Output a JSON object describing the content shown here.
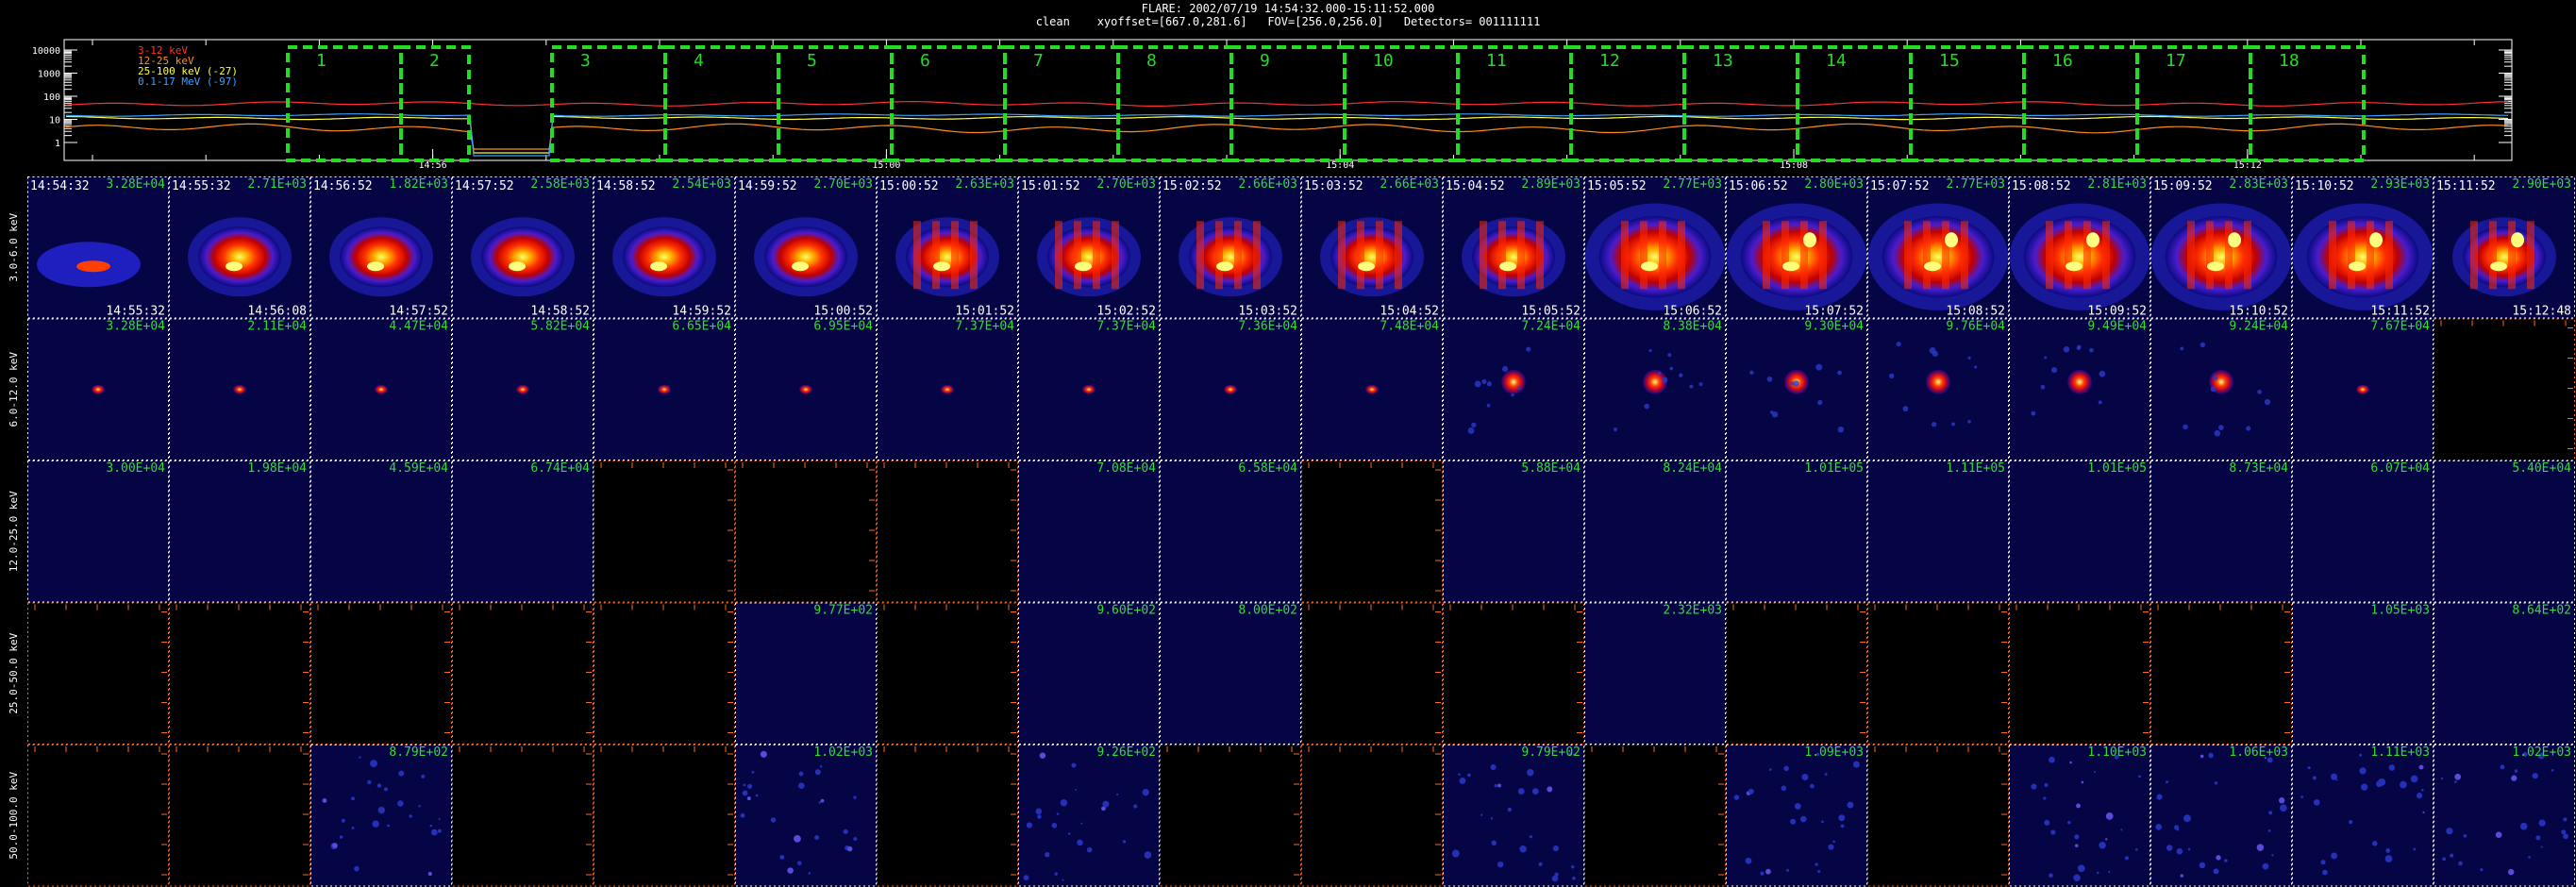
{
  "header": {
    "line1": "FLARE: 2002/07/19 14:54:32.000-15:11:52.000",
    "line2": "clean    xyoffset=[667.0,281.6]   FOV=[256.0,256.0]   Detectors= 001111111"
  },
  "lightcurve": {
    "y_ticks": [
      "10000",
      "1000",
      "100",
      "10",
      "1"
    ],
    "x_ticks": [
      "14:56",
      "15:00",
      "15:04",
      "15:08",
      "15:12"
    ],
    "legend": [
      {
        "label": "3-12 keV",
        "color": "#ff3030"
      },
      {
        "label": "12-25 keV",
        "color": "#ff8c1a"
      },
      {
        "label": "25-100 keV (-27)",
        "color": "#ffff40"
      },
      {
        "label": "0.1-17 MeV (-97)",
        "color": "#3aa0ff"
      }
    ],
    "interval_labels": [
      "1",
      "2",
      "3",
      "4",
      "5",
      "6",
      "7",
      "8",
      "9",
      "10",
      "11",
      "12",
      "13",
      "14",
      "15",
      "16",
      "17",
      "18"
    ],
    "interval_color": "#22dd22"
  },
  "grid": {
    "rows": [
      {
        "label": "3.0-6.0 keV"
      },
      {
        "label": "6.0-12.0 keV"
      },
      {
        "label": "12.0-25.0 keV"
      },
      {
        "label": "25.0-50.0 keV"
      },
      {
        "label": "50.0-100.0 keV"
      }
    ],
    "start_times": [
      "14:54:32",
      "14:55:32",
      "14:56:52",
      "14:57:52",
      "14:58:52",
      "14:59:52",
      "15:00:52",
      "15:01:52",
      "15:02:52",
      "15:03:52",
      "15:04:52",
      "15:05:52",
      "15:06:52",
      "15:07:52",
      "15:08:52",
      "15:09:52",
      "15:10:52",
      "15:11:52"
    ],
    "end_times": [
      "14:55:32",
      "14:56:08",
      "14:57:52",
      "14:58:52",
      "14:59:52",
      "15:00:52",
      "15:01:52",
      "15:02:52",
      "15:03:52",
      "15:04:52",
      "15:05:52",
      "15:06:52",
      "15:07:52",
      "15:08:52",
      "15:09:52",
      "15:10:52",
      "15:11:52",
      "15:12:48"
    ],
    "flux": [
      [
        "3.28E+04",
        "2.71E+03",
        "1.82E+03",
        "2.58E+03",
        "2.54E+03",
        "2.70E+03",
        "2.63E+03",
        "2.70E+03",
        "2.66E+03",
        "2.66E+03",
        "2.89E+03",
        "2.77E+03",
        "2.80E+03",
        "2.77E+03",
        "2.81E+03",
        "2.83E+03",
        "2.93E+03",
        "2.90E+03"
      ],
      [
        "3.28E+04",
        "2.11E+04",
        "4.47E+04",
        "5.82E+04",
        "6.65E+04",
        "6.95E+04",
        "7.37E+04",
        "7.37E+04",
        "7.36E+04",
        "7.48E+04",
        "7.24E+04",
        "8.38E+04",
        "9.30E+04",
        "9.76E+04",
        "9.49E+04",
        "9.24E+04",
        "7.67E+04",
        ""
      ],
      [
        "3.00E+04",
        "1.98E+04",
        "4.59E+04",
        "6.74E+04",
        "",
        "",
        "",
        "7.08E+04",
        "6.58E+04",
        "",
        "5.88E+04",
        "8.24E+04",
        "1.01E+05",
        "1.11E+05",
        "1.01E+05",
        "8.73E+04",
        "6.07E+04",
        "5.40E+04"
      ],
      [
        "",
        "",
        "",
        "",
        "",
        "9.77E+02",
        "",
        "9.60E+02",
        "8.00E+02",
        "",
        "",
        "2.32E+03",
        "",
        "",
        "",
        "",
        "1.05E+03",
        "8.64E+02"
      ],
      [
        "",
        "",
        "8.79E+02",
        "",
        "",
        "1.02E+03",
        "",
        "9.26E+02",
        "",
        "",
        "9.79E+02",
        "",
        "1.09E+03",
        "",
        "1.10E+03",
        "1.06E+03",
        "1.11E+03",
        "1.02E+03"
      ]
    ],
    "images": [
      [
        "flare",
        "flare",
        "flare",
        "flare",
        "flare",
        "flare",
        "flare",
        "flare",
        "flare",
        "flare",
        "flare",
        "flare",
        "flare",
        "flare",
        "flare",
        "flare",
        "flare",
        "flare"
      ],
      [
        "point",
        "faint",
        "point",
        "point",
        "point",
        "point",
        "point",
        "point",
        "point",
        "point",
        "point",
        "point",
        "point",
        "point",
        "point",
        "point",
        "faint",
        "empty"
      ],
      [
        "dim",
        "dim",
        "dim",
        "dim",
        "empty",
        "empty",
        "empty",
        "dim",
        "dim",
        "empty",
        "dim",
        "dim",
        "dim",
        "dim",
        "dim",
        "dim",
        "dim",
        "dim"
      ],
      [
        "empty",
        "empty",
        "empty",
        "empty",
        "empty",
        "dim",
        "empty",
        "dim",
        "dim",
        "empty",
        "empty",
        "dim",
        "empty",
        "empty",
        "empty",
        "empty",
        "dim",
        "dim"
      ],
      [
        "empty",
        "empty",
        "noise",
        "empty",
        "empty",
        "noise",
        "empty",
        "noise",
        "empty",
        "empty",
        "noise",
        "empty",
        "noise",
        "empty",
        "noise",
        "noise",
        "noise",
        "noise"
      ]
    ],
    "colors": {
      "time": "#ffffff",
      "flux": "#33dd33",
      "empty_axis": "#ff6a1a",
      "grid": "#ffffff"
    }
  }
}
